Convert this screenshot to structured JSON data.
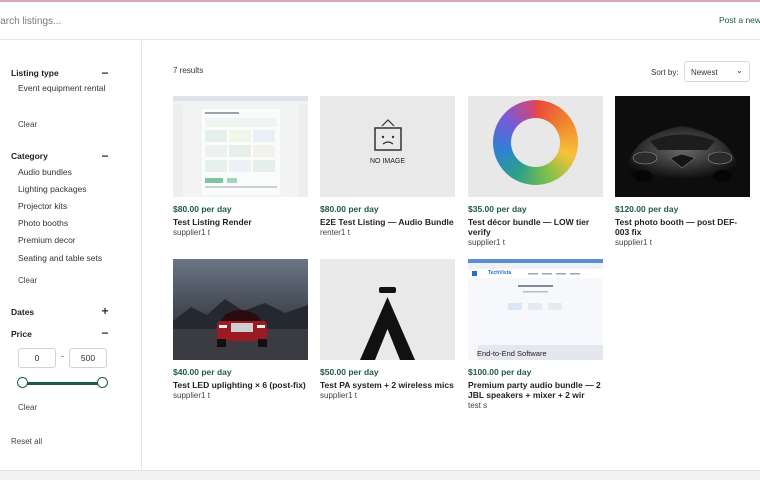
{
  "header": {
    "search_placeholder": "Search listings...",
    "post_link": "Post a new l"
  },
  "sidebar": {
    "listing_type": {
      "title": "Listing type",
      "toggle": "−",
      "options": [
        "Event equipment rental"
      ],
      "clear": "Clear"
    },
    "category": {
      "title": "Category",
      "toggle": "−",
      "options": [
        "Audio bundles",
        "Lighting packages",
        "Projector kits",
        "Photo booths",
        "Premium decor",
        "Seating and table sets"
      ],
      "clear": "Clear"
    },
    "dates": {
      "title": "Dates",
      "toggle": "+"
    },
    "price": {
      "title": "Price",
      "toggle": "−",
      "min": "0",
      "dash": "-",
      "max": "500",
      "clear": "Clear"
    },
    "reset_all": "Reset all"
  },
  "results": {
    "count_label": "7 results"
  },
  "sort": {
    "label": "Sort by:",
    "value": "Newest"
  },
  "listings": [
    {
      "price": "$80.00 per day",
      "title": "Test Listing Render",
      "owner": "supplier1 t"
    },
    {
      "price": "$80.00 per day",
      "title": "E2E Test Listing — Audio Bundle",
      "owner": "renter1 t",
      "placeholder_text": "NO IMAGE"
    },
    {
      "price": "$35.00 per day",
      "title": "Test décor bundle — LOW tier verify",
      "owner": "supplier1 t"
    },
    {
      "price": "$120.00 per day",
      "title": "Test photo booth — post DEF-003 fix",
      "owner": "supplier1 t"
    },
    {
      "price": "$40.00 per day",
      "title": "Test LED uplighting × 6 (post-fix)",
      "owner": "supplier1 t"
    },
    {
      "price": "$50.00 per day",
      "title": "Test PA system + 2 wireless mics",
      "owner": "supplier1 t"
    },
    {
      "price": "$100.00 per day",
      "title": "Premium party audio bundle — 2 JBL speakers + mixer + 2 wir",
      "owner": "test s",
      "screenshot_brand": "TechVista",
      "screenshot_caption": "End-to-End Software"
    }
  ],
  "colors": {
    "accent": "#1f5a4a",
    "border": "#e6e6e6"
  }
}
